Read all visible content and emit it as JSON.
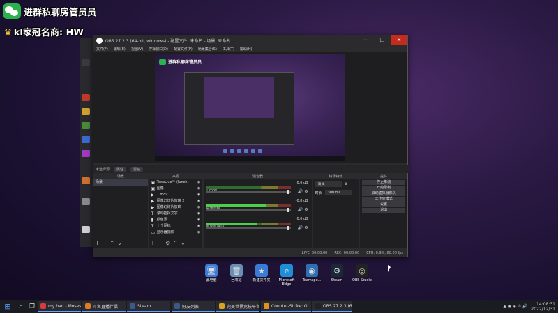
{
  "overlay": {
    "line1": "进群私聊房管员员",
    "line2": "kl家冠名商: HW"
  },
  "obs": {
    "title": "OBS 27.2.3 (64-bit, windows) - 配置文件: 未命名 - 场景: 未命名",
    "menu": [
      "文件(F)",
      "编辑(E)",
      "视图(V)",
      "停靠窗口(D)",
      "配置文件(P)",
      "场景集合(S)",
      "工具(T)",
      "帮助(H)"
    ],
    "source_bar": {
      "label": "未选择源",
      "props": "属性",
      "filters": "滤镜"
    },
    "docks": {
      "scenes": {
        "header": "场景",
        "items": [
          "场景"
        ]
      },
      "sources": {
        "header": "来源",
        "items": [
          {
            "name": "TeepLive™ (lunch)",
            "icon": "▣"
          },
          {
            "name": "图像",
            "icon": "▣"
          },
          {
            "name": "1.mov",
            "icon": "▶"
          },
          {
            "name": "图像幻灯片放映 2",
            "icon": "▶"
          },
          {
            "name": "图像幻灯片放映",
            "icon": "▶"
          },
          {
            "name": "滚动指挥文字",
            "icon": "T"
          },
          {
            "name": "颜色源",
            "icon": "▮"
          },
          {
            "name": "上个图标",
            "icon": "T"
          },
          {
            "name": "显示器捕获",
            "icon": "▭"
          }
        ]
      },
      "mixer": {
        "header": "混音器",
        "channels": [
          {
            "name": "1.mov",
            "db": "0.0 dB",
            "level": 0.0
          },
          {
            "name": "桌面音频",
            "db": "-0.8 dB",
            "level": 0.7
          },
          {
            "name": "麦克风/Aux",
            "db": "0.0 dB",
            "level": 0.6
          }
        ]
      },
      "transitions": {
        "header": "转场特效",
        "type": "淡出",
        "duration_label": "时长",
        "duration": "300 ms"
      },
      "controls": {
        "header": "控件",
        "buttons": [
          "停止推流",
          "开始录制",
          "启动虚拟摄像机",
          "工作室模式",
          "设置",
          "退出"
        ]
      }
    },
    "status": {
      "live": "LIVE: 00:00:00",
      "rec": "REC: 00:00:00",
      "cpu": "CPU: 0.9%, 60.00 fps"
    }
  },
  "preview": {
    "badge": "进群私聊房管员员"
  },
  "desktop_icons": [
    {
      "label": "此电脑",
      "icon": "pc-icon",
      "glyph": "🖥",
      "color": "#3a7bd5"
    },
    {
      "label": "回收站",
      "icon": "recycle-bin-icon",
      "glyph": "🗑",
      "color": "#6a8fb5"
    },
    {
      "label": "新建文件夹",
      "icon": "star-folder-icon",
      "glyph": "★",
      "color": "#3a7bd5"
    },
    {
      "label": "Microsoft Edge",
      "icon": "edge-icon",
      "glyph": "e",
      "color": "#1e8fd6"
    },
    {
      "label": "Teamspe...",
      "icon": "teamspeak-icon",
      "glyph": "◉",
      "color": "#2d6fb0"
    },
    {
      "label": "Steam",
      "icon": "steam-icon",
      "glyph": "⚙",
      "color": "#1b2838"
    },
    {
      "label": "OBS Studio",
      "icon": "obs-icon",
      "glyph": "◎",
      "color": "#222"
    }
  ],
  "taskbar": {
    "tasks": [
      {
        "label": "my bad - Moses",
        "color": "#d93a3a"
      },
      {
        "label": "斗鱼直播伴侣",
        "color": "#e07b1f"
      },
      {
        "label": "Steam",
        "color": "#3a5a8a"
      },
      {
        "label": "好友列表",
        "color": "#3a5a8a"
      },
      {
        "label": "完美世界竞技平台",
        "color": "#d9a41f"
      },
      {
        "label": "Counter-Strike: Gl...",
        "color": "#e0901f"
      },
      {
        "label": "OBS 27.2.3 (64-bit...",
        "color": "#222"
      }
    ],
    "clock_time": "14:08:31",
    "clock_date": "2022/12/31"
  }
}
